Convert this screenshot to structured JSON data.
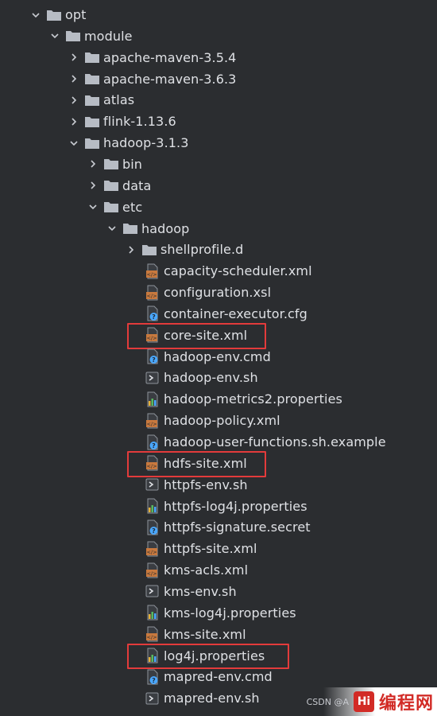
{
  "colors": {
    "background": "#2b2d30",
    "text": "#dfe1e5",
    "folder": "#b7bcc4",
    "xml_icon": "#c8793e",
    "question_icon": "#4aa8ff",
    "highlight_border": "#e33b3b"
  },
  "tree": {
    "items": [
      {
        "label": "opt",
        "kind": "folder",
        "expanded": true,
        "depth": 0
      },
      {
        "label": "module",
        "kind": "folder",
        "expanded": true,
        "depth": 1
      },
      {
        "label": "apache-maven-3.5.4",
        "kind": "folder",
        "expanded": false,
        "depth": 2
      },
      {
        "label": "apache-maven-3.6.3",
        "kind": "folder",
        "expanded": false,
        "depth": 2
      },
      {
        "label": "atlas",
        "kind": "folder",
        "expanded": false,
        "depth": 2
      },
      {
        "label": "flink-1.13.6",
        "kind": "folder",
        "expanded": false,
        "depth": 2
      },
      {
        "label": "hadoop-3.1.3",
        "kind": "folder",
        "expanded": true,
        "depth": 2
      },
      {
        "label": "bin",
        "kind": "folder",
        "expanded": false,
        "depth": 3
      },
      {
        "label": "data",
        "kind": "folder",
        "expanded": false,
        "depth": 3
      },
      {
        "label": "etc",
        "kind": "folder",
        "expanded": true,
        "depth": 3
      },
      {
        "label": "hadoop",
        "kind": "folder",
        "expanded": true,
        "depth": 4
      },
      {
        "label": "shellprofile.d",
        "kind": "folder",
        "expanded": false,
        "depth": 5
      },
      {
        "label": "capacity-scheduler.xml",
        "kind": "xml",
        "depth": 6
      },
      {
        "label": "configuration.xsl",
        "kind": "xml",
        "depth": 6
      },
      {
        "label": "container-executor.cfg",
        "kind": "unknown",
        "depth": 6
      },
      {
        "label": "core-site.xml",
        "kind": "xml",
        "depth": 6,
        "highlighted": true
      },
      {
        "label": "hadoop-env.cmd",
        "kind": "unknown",
        "depth": 6
      },
      {
        "label": "hadoop-env.sh",
        "kind": "shell",
        "depth": 6
      },
      {
        "label": "hadoop-metrics2.properties",
        "kind": "properties",
        "depth": 6
      },
      {
        "label": "hadoop-policy.xml",
        "kind": "xml",
        "depth": 6
      },
      {
        "label": "hadoop-user-functions.sh.example",
        "kind": "unknown",
        "depth": 6
      },
      {
        "label": "hdfs-site.xml",
        "kind": "xml",
        "depth": 6,
        "highlighted": true
      },
      {
        "label": "httpfs-env.sh",
        "kind": "shell",
        "depth": 6
      },
      {
        "label": "httpfs-log4j.properties",
        "kind": "properties",
        "depth": 6
      },
      {
        "label": "httpfs-signature.secret",
        "kind": "unknown",
        "depth": 6
      },
      {
        "label": "httpfs-site.xml",
        "kind": "xml",
        "depth": 6
      },
      {
        "label": "kms-acls.xml",
        "kind": "xml",
        "depth": 6
      },
      {
        "label": "kms-env.sh",
        "kind": "shell",
        "depth": 6
      },
      {
        "label": "kms-log4j.properties",
        "kind": "properties",
        "depth": 6
      },
      {
        "label": "kms-site.xml",
        "kind": "xml",
        "depth": 6
      },
      {
        "label": "log4j.properties",
        "kind": "properties",
        "depth": 6,
        "highlighted": true
      },
      {
        "label": "mapred-env.cmd",
        "kind": "unknown",
        "depth": 6
      },
      {
        "label": "mapred-env.sh",
        "kind": "shell",
        "depth": 6
      }
    ]
  },
  "watermark": {
    "csdn_text": "CSDN @A",
    "logo_text": "Hi",
    "site_text": "编程网"
  }
}
